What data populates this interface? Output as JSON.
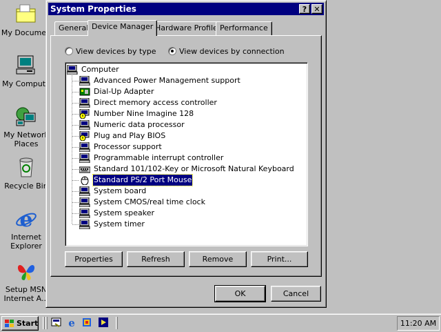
{
  "desktop": {
    "icons": [
      {
        "label": "My Documen",
        "icon": "folder-icon"
      },
      {
        "label": "My Compute",
        "icon": "computer-icon"
      },
      {
        "label": "My Network Places",
        "icon": "network-icon"
      },
      {
        "label": "Recycle Bin",
        "icon": "recycle-bin-icon"
      },
      {
        "label": "Internet Explorer",
        "icon": "ie-icon"
      },
      {
        "label": "Setup MSN Internet A...",
        "icon": "msn-butterfly-icon"
      }
    ]
  },
  "window": {
    "title": "System Properties",
    "help_btn": "?",
    "close_btn": "✕",
    "tabs": [
      "General",
      "Device Manager",
      "Hardware Profiles",
      "Performance"
    ],
    "active_tab": "Device Manager",
    "radios": [
      {
        "label": "View devices by type",
        "checked": false
      },
      {
        "label": "View devices by connection",
        "checked": true
      }
    ],
    "tree": {
      "root": "Computer",
      "items": [
        {
          "label": "Advanced Power Management support",
          "icon": "device-icon",
          "selected": false
        },
        {
          "label": "Dial-Up Adapter",
          "icon": "network-adapter-icon",
          "selected": false
        },
        {
          "label": "Direct memory access controller",
          "icon": "device-icon",
          "selected": false
        },
        {
          "label": "Number Nine Imagine 128",
          "icon": "warning-device-icon",
          "selected": false
        },
        {
          "label": "Numeric data processor",
          "icon": "device-icon",
          "selected": false
        },
        {
          "label": "Plug and Play BIOS",
          "icon": "warning-device-icon",
          "selected": false
        },
        {
          "label": "Processor support",
          "icon": "device-icon",
          "selected": false
        },
        {
          "label": "Programmable interrupt controller",
          "icon": "device-icon",
          "selected": false
        },
        {
          "label": "Standard 101/102-Key or Microsoft Natural Keyboard",
          "icon": "keyboard-icon",
          "selected": false
        },
        {
          "label": "Standard PS/2 Port Mouse",
          "icon": "mouse-icon",
          "selected": true
        },
        {
          "label": "System board",
          "icon": "device-icon",
          "selected": false
        },
        {
          "label": "System CMOS/real time clock",
          "icon": "device-icon",
          "selected": false
        },
        {
          "label": "System speaker",
          "icon": "device-icon",
          "selected": false
        },
        {
          "label": "System timer",
          "icon": "device-icon",
          "selected": false
        }
      ]
    },
    "buttons": {
      "properties": "Properties",
      "refresh": "Refresh",
      "remove": "Remove",
      "print": "Print...",
      "ok": "OK",
      "cancel": "Cancel"
    }
  },
  "taskbar": {
    "start": "Start",
    "quick_launch": [
      "desktop-icon",
      "ie-icon",
      "channels-icon",
      "media-player-icon"
    ],
    "clock": "11:20 AM"
  },
  "colors": {
    "desktop": "#c0c0c0",
    "titlebar": "#000080",
    "selection": "#000080"
  }
}
